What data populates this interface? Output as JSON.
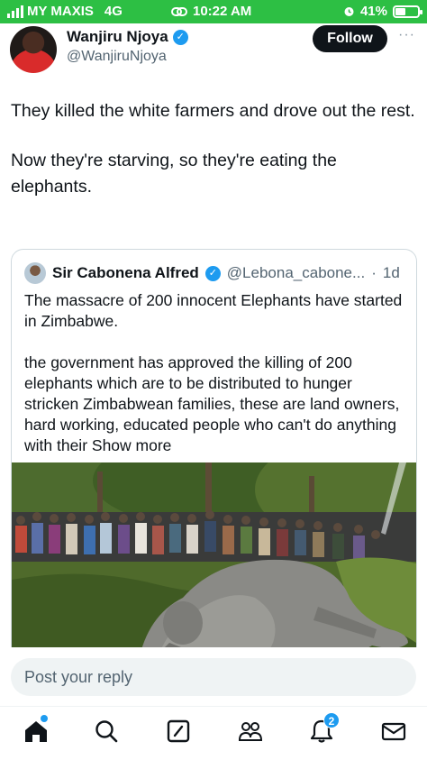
{
  "status_bar": {
    "carrier": "MY MAXIS",
    "network": "4G",
    "time": "10:22 AM",
    "battery": "41%",
    "battery_level": 0.41
  },
  "tweet": {
    "author_name": "Wanjiru Njoya",
    "author_handle": "@WanjiruNjoya",
    "follow_label": "Follow",
    "more_label": "···",
    "paragraphs": [
      "They killed the white farmers and drove out the rest.",
      "Now they're starving, so they're eating the elephants."
    ]
  },
  "quote": {
    "author_name": "Sir Cabonena Alfred",
    "author_handle": "@Lebona_cabone...",
    "separator": "·",
    "time": "1d",
    "paragraph1": "The massacre of 200 innocent Elephants have started in Zimbabwe.",
    "paragraph2": "the government has approved the killing of 200 elephants which are to be distributed to hunger stricken Zimbabwean families, these are land owners, hard working,  educated people who can't do anything with their",
    "show_more": "Show more"
  },
  "reply": {
    "placeholder": "Post your reply"
  },
  "nav": {
    "notifications_count": "2"
  },
  "colors": {
    "status_bar": "#2dbf44",
    "accent": "#1d9bf0",
    "text": "#0f1419",
    "secondary": "#536471"
  }
}
